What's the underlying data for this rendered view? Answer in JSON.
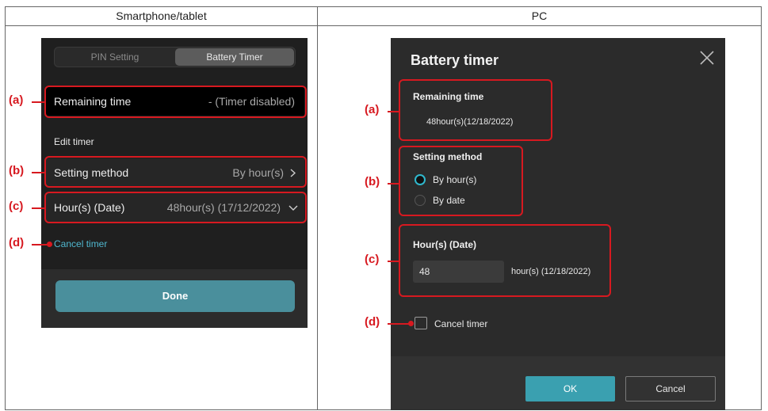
{
  "columns": {
    "mobile": "Smartphone/tablet",
    "pc": "PC"
  },
  "callouts": {
    "a": "(a)",
    "b": "(b)",
    "c": "(c)",
    "d": "(d)"
  },
  "mobile": {
    "tabs": [
      "PIN Setting",
      "Battery Timer"
    ],
    "active_tab": "Battery Timer",
    "remaining_label": "Remaining time",
    "remaining_value": "- (Timer disabled)",
    "edit_timer_heading": "Edit timer",
    "setting_method_label": "Setting method",
    "setting_method_value": "By hour(s)",
    "hours_label": "Hour(s) (Date)",
    "hours_value": "48hour(s) (17/12/2022)",
    "cancel_timer_link": "Cancel timer",
    "done_button": "Done"
  },
  "pc": {
    "title": "Battery timer",
    "remaining_heading": "Remaining time",
    "remaining_value": "48hour(s)(12/18/2022)",
    "setting_method_heading": "Setting method",
    "radio_options": [
      "By hour(s)",
      "By date"
    ],
    "selected_option": "By hour(s)",
    "hours_heading": "Hour(s) (Date)",
    "hours_input_value": "48",
    "hours_suffix": "hour(s) (12/18/2022)",
    "cancel_timer_label": "Cancel timer",
    "cancel_timer_checked": false,
    "ok_button": "OK",
    "cancel_button": "Cancel"
  },
  "colors": {
    "annotation_red": "#d71920",
    "accent_teal": "#3aa0b0"
  }
}
